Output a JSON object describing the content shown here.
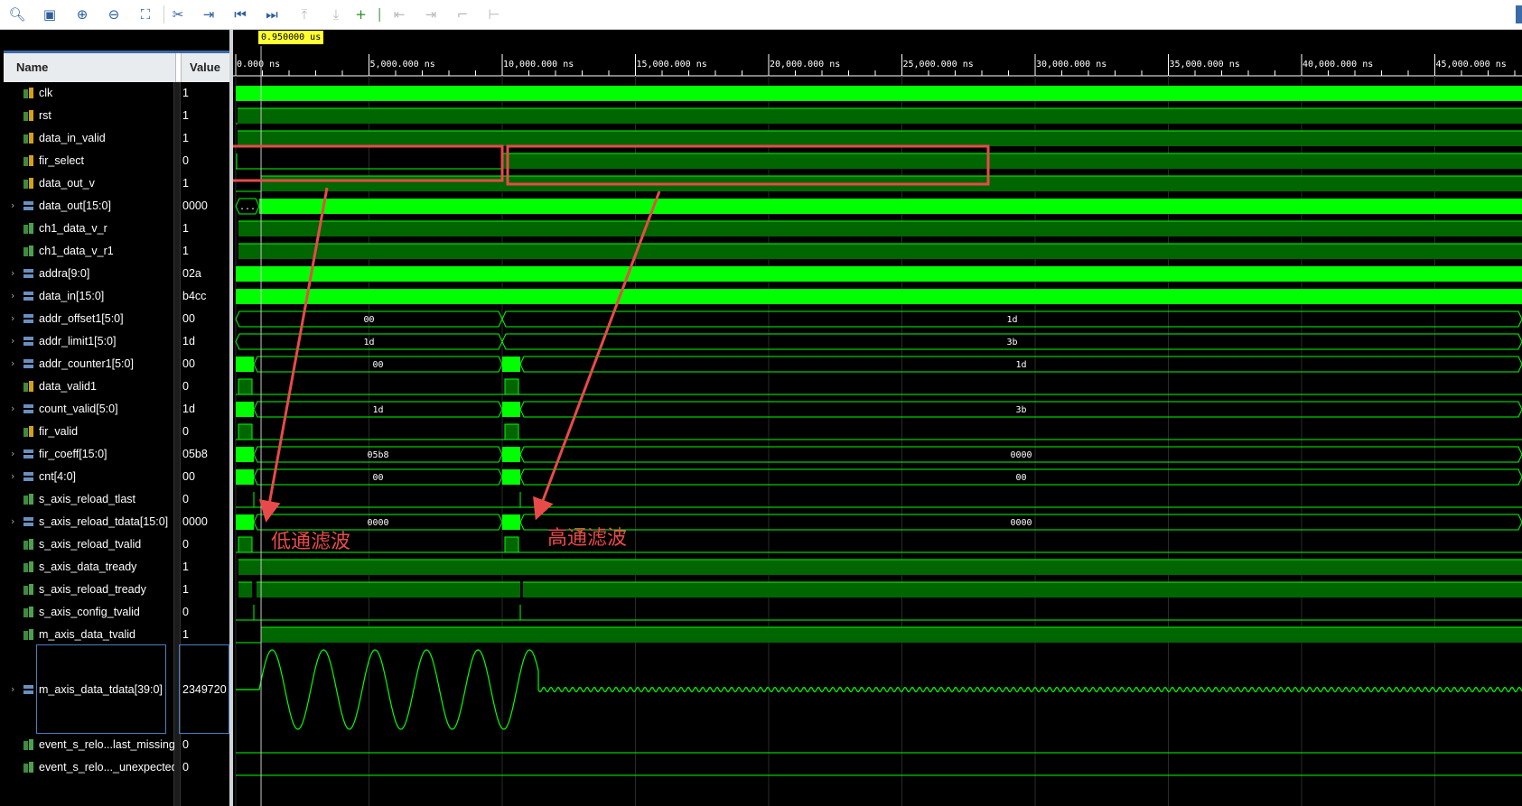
{
  "toolbar": {
    "icons": [
      "search-icon",
      "save-icon",
      "zoom-in-icon",
      "zoom-out-icon",
      "zoom-fit-icon",
      "cursor-to-zero-icon",
      "go-to-cursor-icon",
      "go-to-start-icon",
      "go-to-end-icon",
      "previous-transition-icon",
      "next-transition-icon",
      "add-marker-icon",
      "previous-marker-icon",
      "next-marker-icon",
      "swap-cursors-icon",
      "snap-icon"
    ]
  },
  "cursor": {
    "value_label": "0.950000 us",
    "time_ns": 950
  },
  "header": {
    "name": "Name",
    "value": "Value"
  },
  "timeline": {
    "ticks": [
      {
        "label": "0.000 ns",
        "ns": 0
      },
      {
        "label": "5,000.000 ns",
        "ns": 5000
      },
      {
        "label": "10,000.000 ns",
        "ns": 10000
      },
      {
        "label": "15,000.000 ns",
        "ns": 15000
      },
      {
        "label": "20,000.000 ns",
        "ns": 20000
      },
      {
        "label": "25,000.000 ns",
        "ns": 25000
      },
      {
        "label": "30,000.000 ns",
        "ns": 30000
      },
      {
        "label": "35,000.000 ns",
        "ns": 35000
      },
      {
        "label": "40,000.000 ns",
        "ns": 40000
      },
      {
        "label": "45,000.000 ns",
        "ns": 45000
      }
    ]
  },
  "signals": [
    {
      "name": "clk",
      "value": "1",
      "bus": false,
      "expandable": false
    },
    {
      "name": "rst",
      "value": "1",
      "bus": false,
      "expandable": false
    },
    {
      "name": "data_in_valid",
      "value": "1",
      "bus": false,
      "expandable": false
    },
    {
      "name": "fir_select",
      "value": "0",
      "bus": false,
      "expandable": false
    },
    {
      "name": "data_out_v",
      "value": "1",
      "bus": false,
      "expandable": false
    },
    {
      "name": "data_out[15:0]",
      "value": "0000",
      "bus": true,
      "expandable": true
    },
    {
      "name": "ch1_data_v_r",
      "value": "1",
      "bus": false,
      "expandable": false
    },
    {
      "name": "ch1_data_v_r1",
      "value": "1",
      "bus": false,
      "expandable": false
    },
    {
      "name": "addra[9:0]",
      "value": "02a",
      "bus": true,
      "expandable": true
    },
    {
      "name": "data_in[15:0]",
      "value": "b4cc",
      "bus": true,
      "expandable": true
    },
    {
      "name": "addr_offset1[5:0]",
      "value": "00",
      "bus": true,
      "expandable": true,
      "segments": [
        "00",
        "1d"
      ]
    },
    {
      "name": "addr_limit1[5:0]",
      "value": "1d",
      "bus": true,
      "expandable": true,
      "segments": [
        "1d",
        "3b"
      ]
    },
    {
      "name": "addr_counter1[5:0]",
      "value": "00",
      "bus": true,
      "expandable": true,
      "segments": [
        "00",
        "1d"
      ]
    },
    {
      "name": "data_valid1",
      "value": "0",
      "bus": false,
      "expandable": false
    },
    {
      "name": "count_valid[5:0]",
      "value": "1d",
      "bus": true,
      "expandable": true,
      "segments": [
        "1d",
        "3b"
      ]
    },
    {
      "name": "fir_valid",
      "value": "0",
      "bus": false,
      "expandable": false
    },
    {
      "name": "fir_coeff[15:0]",
      "value": "05b8",
      "bus": true,
      "expandable": true,
      "segments": [
        "05b8",
        "0000"
      ]
    },
    {
      "name": "cnt[4:0]",
      "value": "00",
      "bus": true,
      "expandable": true,
      "segments": [
        "00",
        "00"
      ]
    },
    {
      "name": "s_axis_reload_tlast",
      "value": "0",
      "bus": false,
      "expandable": false
    },
    {
      "name": "s_axis_reload_tdata[15:0]",
      "value": "0000",
      "bus": true,
      "expandable": true,
      "segments": [
        "0000",
        "0000"
      ]
    },
    {
      "name": "s_axis_reload_tvalid",
      "value": "0",
      "bus": false,
      "expandable": false
    },
    {
      "name": "s_axis_data_tready",
      "value": "1",
      "bus": false,
      "expandable": false
    },
    {
      "name": "s_axis_reload_tready",
      "value": "1",
      "bus": false,
      "expandable": false
    },
    {
      "name": "s_axis_config_tvalid",
      "value": "0",
      "bus": false,
      "expandable": false
    },
    {
      "name": "m_axis_data_tvalid",
      "value": "1",
      "bus": false,
      "expandable": false
    },
    {
      "name": "m_axis_data_tdata[39:0]",
      "value": "2349720",
      "bus": true,
      "expandable": true
    },
    {
      "name": "event_s_relo...last_missing",
      "value": "0",
      "bus": false,
      "expandable": false
    },
    {
      "name": "event_s_relo..._unexpected",
      "value": "0",
      "bus": false,
      "expandable": false
    }
  ],
  "annotations": {
    "lowpass": "低通滤波",
    "highpass": "高通滤波"
  },
  "colors": {
    "wave": "#00ff00",
    "wave_dark": "#006600",
    "annotation": "#e84a4a",
    "cursor_marker": "#ffff33"
  }
}
